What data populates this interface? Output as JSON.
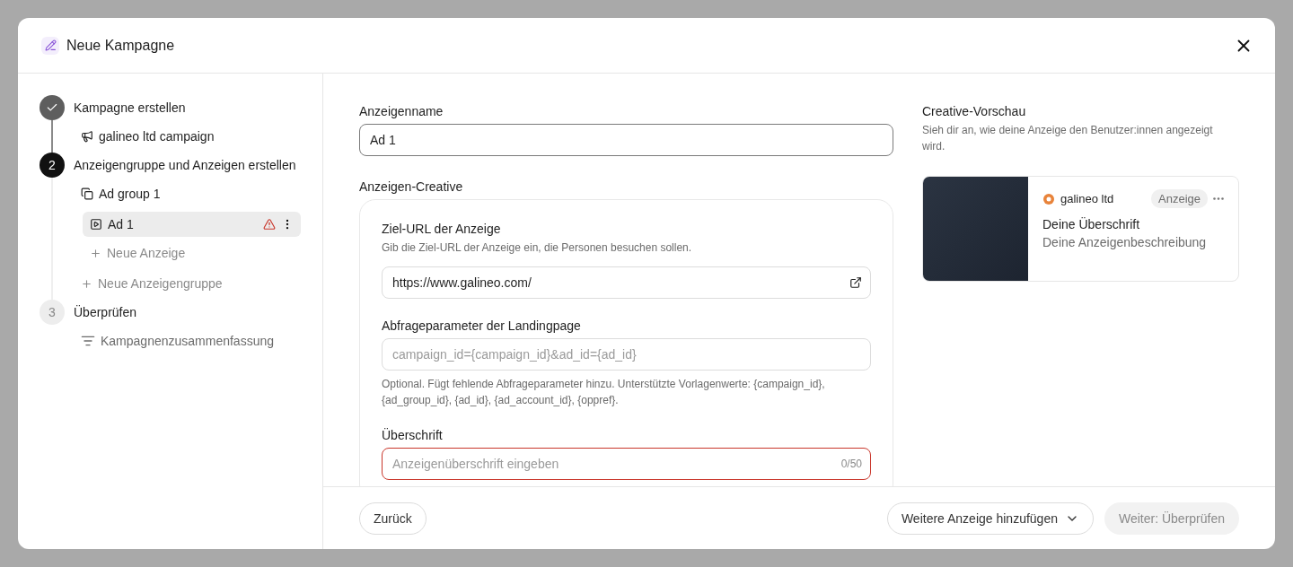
{
  "dialog": {
    "title": "Neue Kampagne"
  },
  "steps": [
    {
      "completed": true,
      "active": false,
      "title": "Kampagne erstellen",
      "children": [
        {
          "kind": "campaign",
          "label": "galineo ltd campaign",
          "selected": false,
          "warning": false
        }
      ]
    },
    {
      "completed": false,
      "active": true,
      "number": "2",
      "title": "Anzeigengruppe und Anzeigen erstellen",
      "children": [
        {
          "kind": "ad_group",
          "label": "Ad group 1",
          "selected": false,
          "warning": false,
          "children": [
            {
              "kind": "ad",
              "label": "Ad 1",
              "selected": true,
              "warning": true
            },
            {
              "kind": "add",
              "label": "Neue Anzeige",
              "selected": false,
              "warning": false
            }
          ]
        },
        {
          "kind": "add",
          "label": "Neue Anzeigengruppe",
          "selected": false,
          "warning": false
        }
      ]
    },
    {
      "completed": false,
      "active": false,
      "number": "3",
      "title": "Überprüfen",
      "children": [
        {
          "kind": "summary",
          "label": "Kampagnenzusammenfassung",
          "selected": false,
          "warning": false
        }
      ]
    }
  ],
  "ad_name": {
    "label": "Anzeigenname",
    "value": "Ad 1"
  },
  "creative": {
    "label": "Anzeigen-Creative",
    "fields": [
      {
        "kind": "url",
        "label": "Ziel-URL der Anzeige",
        "description": "Gib die Ziel-URL der Anzeige ein, die Personen besuchen sollen.",
        "value": "https://www.galineo.com/",
        "error": false
      },
      {
        "kind": "text",
        "label": "Abfrageparameter der Landingpage",
        "placeholder": "campaign_id={campaign_id}&ad_id={ad_id}",
        "help": "Optional. Fügt fehlende Abfrageparameter hinzu. Unterstützte Vorlagenwerte: {campaign_id}, {ad_group_id}, {ad_id}, {ad_account_id}, {oppref}.",
        "error": false
      },
      {
        "kind": "counter",
        "label": "Überschrift",
        "placeholder": "Anzeigenüberschrift eingeben",
        "counter": "0/50",
        "error": true
      }
    ]
  },
  "preview": {
    "title": "Creative-Vorschau",
    "description": "Sieh dir an, wie deine Anzeige den Benutzer:innen angezeigt wird.",
    "card": {
      "brand": "galineo ltd",
      "badge": "Anzeige",
      "headline": "Deine Überschrift",
      "body": "Deine Anzeigenbeschreibung"
    }
  },
  "footer": {
    "back": "Zurück",
    "add_more": "Weitere Anzeige hinzufügen",
    "next": {
      "label": "Weiter: Überprüfen",
      "disabled": true
    }
  }
}
